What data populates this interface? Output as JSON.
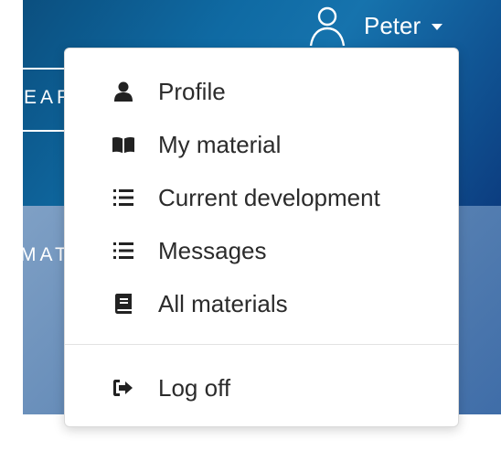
{
  "background": {
    "search_fragment": "EAR",
    "title_fragment": "MAT"
  },
  "header": {
    "user_name": "Peter"
  },
  "menu": {
    "items": [
      {
        "label": "Profile",
        "icon": "user-icon"
      },
      {
        "label": "My material",
        "icon": "book-open-icon"
      },
      {
        "label": "Current development",
        "icon": "list-icon"
      },
      {
        "label": "Messages",
        "icon": "list-icon"
      },
      {
        "label": "All materials",
        "icon": "book-icon"
      }
    ],
    "logout": {
      "label": "Log off",
      "icon": "sign-out-icon"
    }
  },
  "colors": {
    "header_blue": "#0f6aa3",
    "text": "#2b2b2b",
    "icon": "#222222"
  }
}
